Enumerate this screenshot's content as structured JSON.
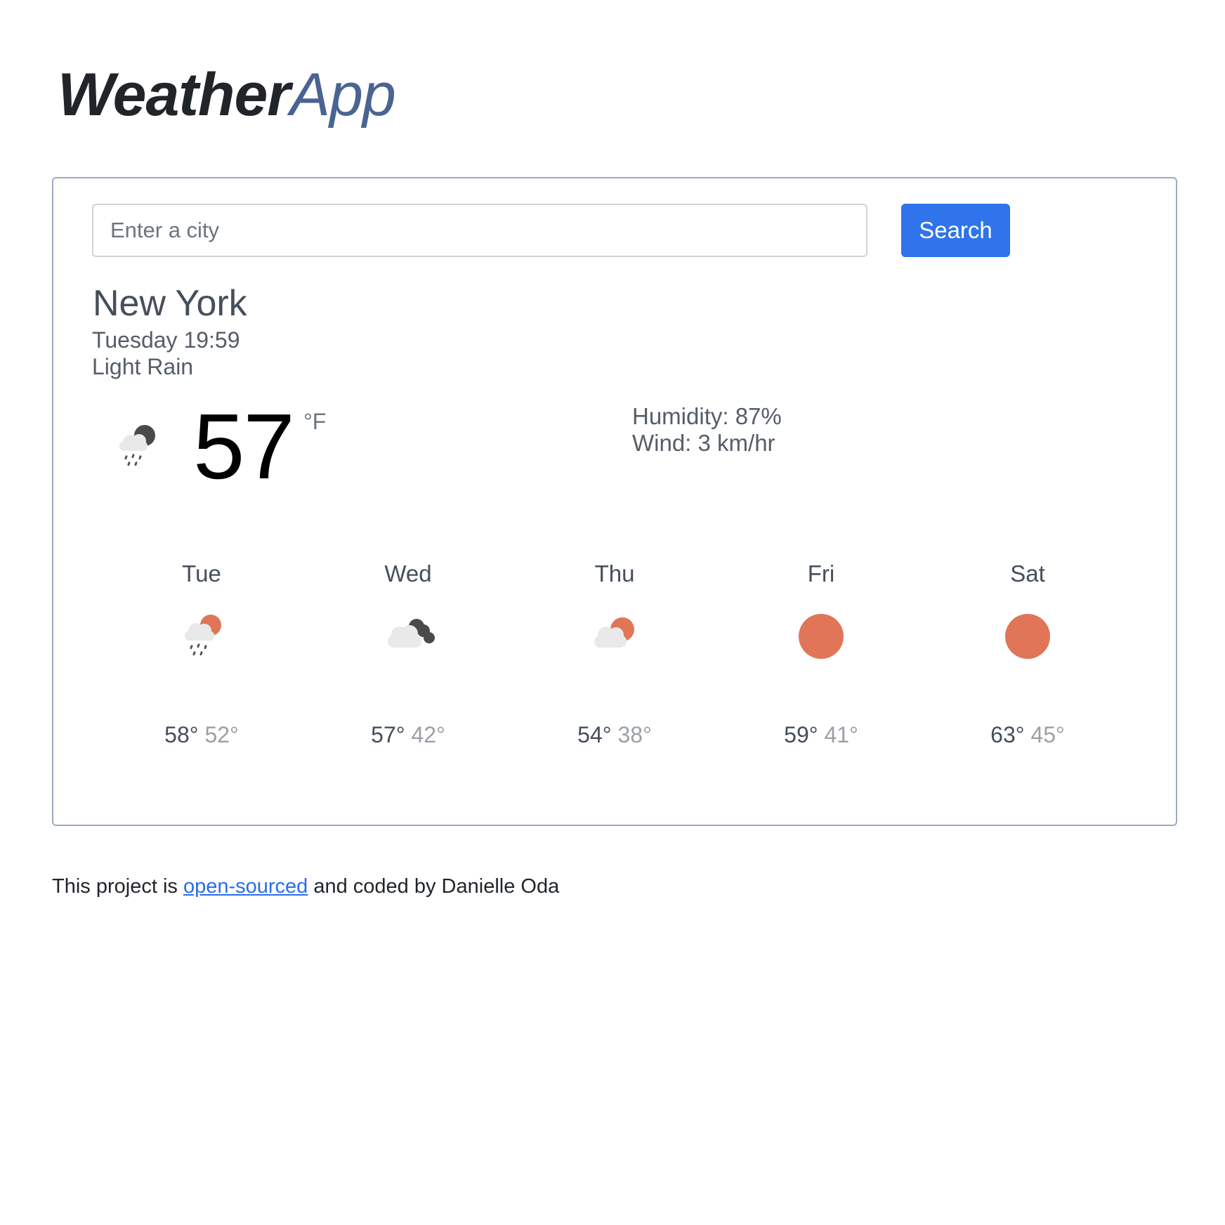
{
  "logo": {
    "bold": "Weather",
    "light": "App"
  },
  "search": {
    "placeholder": "Enter a city",
    "value": "",
    "button_label": "Search"
  },
  "current": {
    "city": "New York",
    "datetime": "Tuesday 19:59",
    "description": "Light Rain",
    "icon": "rain-night-icon",
    "temperature": "57",
    "unit": "°F",
    "humidity": "Humidity: 87%",
    "wind": "Wind: 3 km/hr"
  },
  "forecast": [
    {
      "day": "Tue",
      "icon": "rain-sun-icon",
      "max": "58°",
      "min": "52°"
    },
    {
      "day": "Wed",
      "icon": "cloudy-night-icon",
      "max": "57°",
      "min": "42°"
    },
    {
      "day": "Thu",
      "icon": "partly-cloudy-icon",
      "max": "54°",
      "min": "38°"
    },
    {
      "day": "Fri",
      "icon": "sun-icon",
      "max": "59°",
      "min": "41°"
    },
    {
      "day": "Sat",
      "icon": "sun-icon",
      "max": "63°",
      "min": "45°"
    }
  ],
  "footer": {
    "prefix": "This project is",
    "link_text": "open-sourced",
    "suffix": "and coded by Danielle Oda"
  },
  "colors": {
    "accent": "#2f74eb",
    "logo_light": "#4a6491",
    "sun": "#e07558",
    "dark_cloud": "#4a4a4a",
    "light_cloud": "#e9e9e9"
  }
}
